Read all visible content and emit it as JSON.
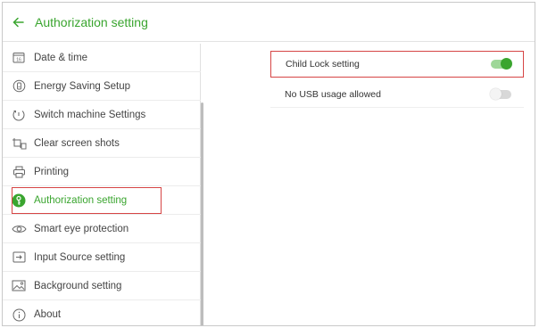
{
  "header": {
    "back_icon": "arrow-left-icon",
    "title": "Authorization setting"
  },
  "sidebar": {
    "items": [
      {
        "label": "Date & time",
        "icon": "calendar-icon",
        "icon_text": "16"
      },
      {
        "label": "Energy Saving Setup",
        "icon": "energy-icon"
      },
      {
        "label": "Switch machine Settings",
        "icon": "power-cycle-icon"
      },
      {
        "label": "Clear screen shots",
        "icon": "clear-screenshot-icon"
      },
      {
        "label": "Printing",
        "icon": "printer-icon"
      },
      {
        "label": "Authorization setting",
        "icon": "key-icon",
        "active": true
      },
      {
        "label": "Smart eye protection",
        "icon": "eye-icon"
      },
      {
        "label": "Input Source setting",
        "icon": "input-source-icon"
      },
      {
        "label": "Background setting",
        "icon": "image-icon"
      },
      {
        "label": "About",
        "icon": "info-icon"
      }
    ]
  },
  "settings": [
    {
      "label": "Child Lock setting",
      "enabled": true
    },
    {
      "label": "No USB usage allowed",
      "enabled": false
    }
  ],
  "colors": {
    "accent": "#3aa52f",
    "highlight_border": "#d64545"
  }
}
